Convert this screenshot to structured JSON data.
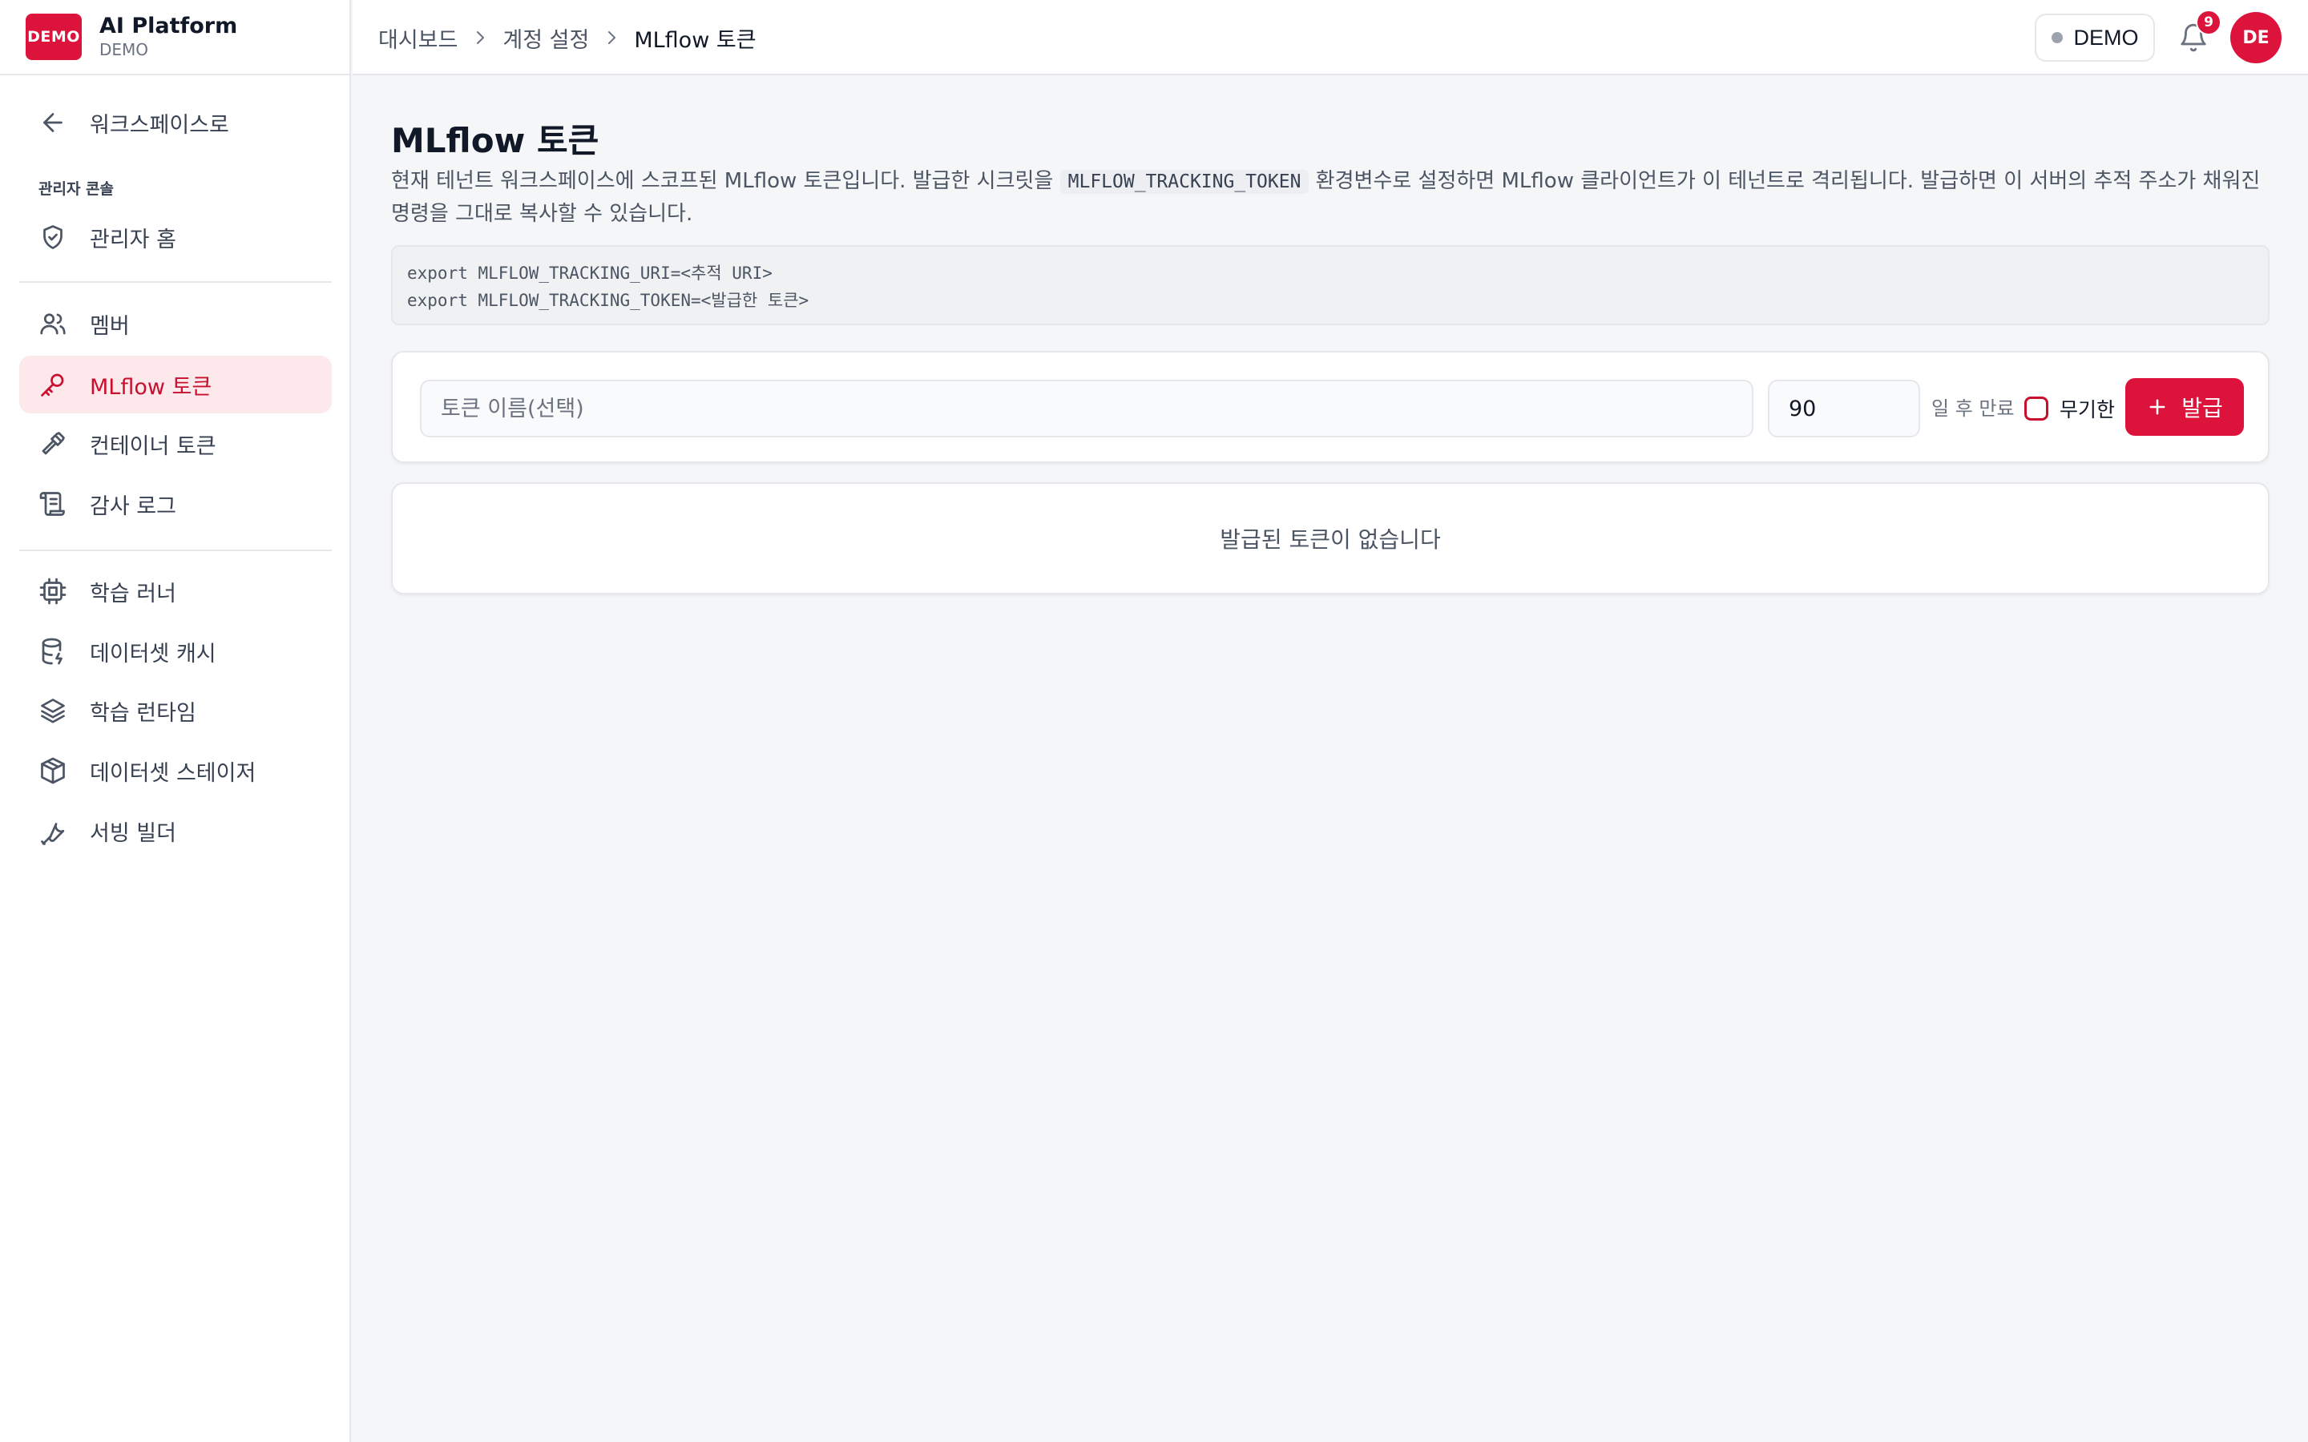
{
  "brand": {
    "logo_text": "DEMO",
    "title": "AI Platform",
    "subtitle": "DEMO"
  },
  "sidebar": {
    "back": {
      "label": "워크스페이스로",
      "icon": "arrow-left-icon"
    },
    "section_label": "관리자 콘솔",
    "items": [
      {
        "label": "관리자 홈",
        "icon": "shield-check-icon"
      },
      {
        "label": "멤버",
        "icon": "users-icon"
      },
      {
        "label": "MLflow 토큰",
        "icon": "key-icon",
        "active": true
      },
      {
        "label": "컨테이너 토큰",
        "icon": "hammer-icon"
      },
      {
        "label": "감사 로그",
        "icon": "scroll-icon"
      },
      {
        "label": "학습 러너",
        "icon": "cpu-icon"
      },
      {
        "label": "데이터셋 캐시",
        "icon": "database-icon"
      },
      {
        "label": "학습 런타임",
        "icon": "layers-icon"
      },
      {
        "label": "데이터셋 스테이저",
        "icon": "package-icon"
      },
      {
        "label": "서빙 빌더",
        "icon": "wrench-icon"
      }
    ]
  },
  "topbar": {
    "breadcrumbs": [
      "대시보드",
      "계정 설정",
      "MLflow 토큰"
    ],
    "tenant_label": "DEMO",
    "notification_count": "9",
    "avatar_initials": "DE"
  },
  "page": {
    "title": "MLflow 토큰",
    "description_part1": "현재 테넌트 워크스페이스에 스코프된 MLflow 토큰입니다. 발급한 시크릿을 ",
    "description_code": "MLFLOW_TRACKING_TOKEN",
    "description_part2": " 환경변수로 설정하면 MLflow 클라이언트가 이 테넌트로 격리됩니다. 발급하면 이 서버의 추적 주소가 채워진 명령을 그대로 복사할 수 있습니다.",
    "code_lines": [
      "export MLFLOW_TRACKING_URI=<추적 URI>",
      "export MLFLOW_TRACKING_TOKEN=<발급한 토큰>"
    ]
  },
  "form": {
    "name_placeholder": "토큰 이름(선택)",
    "days_value": "90",
    "expire_label": "일 후 만료",
    "unlimited_label": "무기한",
    "issue_label": "발급"
  },
  "empty_state": "발급된 토큰이 없습니다",
  "colors": {
    "accent": "#dc143c",
    "active_bg": "#fde8ec"
  }
}
